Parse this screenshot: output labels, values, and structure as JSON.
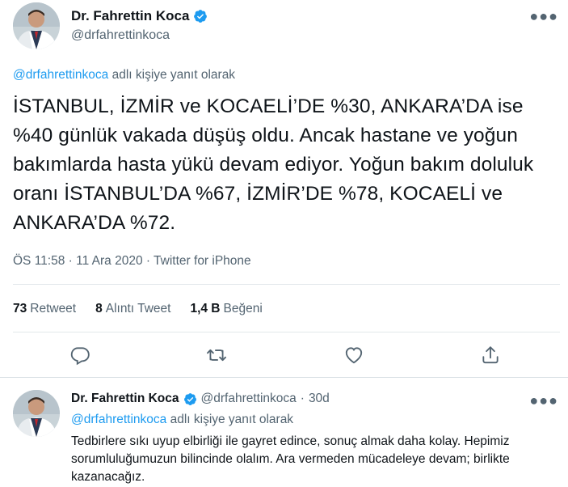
{
  "main_tweet": {
    "author_name": "Dr. Fahrettin Koca",
    "author_handle": "@drfahrettinkoca",
    "reply_to_mention": "@drfahrettinkoca",
    "reply_to_suffix": " adlı kişiye yanıt olarak",
    "text": "İSTANBUL, İZMİR ve KOCAELİ’DE  %30, ANKARA’DA ise %40 günlük vakada düşüş oldu. Ancak hastane ve yoğun bakımlarda hasta yükü devam ediyor. Yoğun bakım doluluk oranı İSTANBUL’DA  %67, İZMİR’DE %78, KOCAELİ ve ANKARA’DA %72.",
    "meta": "ÖS 11:58 · 11 Ara 2020 · Twitter for iPhone",
    "stats": {
      "retweets_count": "73",
      "retweets_label": "Retweet",
      "quotes_count": "8",
      "quotes_label": "Alıntı Tweet",
      "likes_count": "1,4 B",
      "likes_label": "Beğeni"
    },
    "more_icon": "more-horizontal-icon"
  },
  "reply_tweet": {
    "author_name": "Dr. Fahrettin Koca",
    "author_handle": "@drfahrettinkoca",
    "dot": "·",
    "time": "30d",
    "reply_to_mention": "@drfahrettinkoca",
    "reply_to_suffix": " adlı kişiye yanıt olarak",
    "text": "Tedbirlere sıkı uyup elbirliği ile gayret edince, sonuç almak daha kolay. Hepimiz sorumluluğumuzun bilincinde olalım. Ara vermeden mücadeleye devam; birlikte kazanacağız."
  },
  "icons": {
    "reply": "reply-icon",
    "retweet": "retweet-icon",
    "like": "heart-icon",
    "share": "share-icon",
    "verified": "verified-badge-icon"
  },
  "colors": {
    "accent": "#1d9bf0",
    "text": "#0f1419",
    "muted": "#536471",
    "divider": "#e3e8eb"
  }
}
